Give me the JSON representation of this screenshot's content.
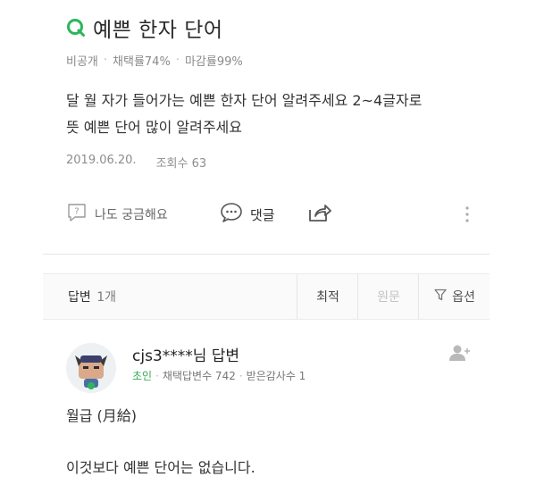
{
  "question": {
    "title": "예쁜 한자 단어",
    "meta": {
      "visibility": "비공개",
      "adopt_rate": "채택률74%",
      "close_rate": "마감률99%"
    },
    "body_line1": "달 월 자가 들어가는 예쁜 한자 단어 알려주세요 2~4글자로",
    "body_line2": "뜻 예쁜 단어 많이 알려주세요",
    "date": "2019.06.20.",
    "views": "조회수 63"
  },
  "actions": {
    "curious_label": "나도 궁금해요",
    "comment_label": "댓글"
  },
  "answers_bar": {
    "label": "답변",
    "count": "1개",
    "sort_best": "최적",
    "sort_original": "원문",
    "options": "옵션"
  },
  "answer": {
    "username": "cjs3****님 답변",
    "level": "초인",
    "adopted_count": "채택답변수 742",
    "thanks_count": "받은감사수 1",
    "line1": "월급 (月給)",
    "line2": "이것보다 예쁜 단어는 없습니다."
  },
  "colors": {
    "accent": "#2db55d",
    "level": "#33a852"
  }
}
